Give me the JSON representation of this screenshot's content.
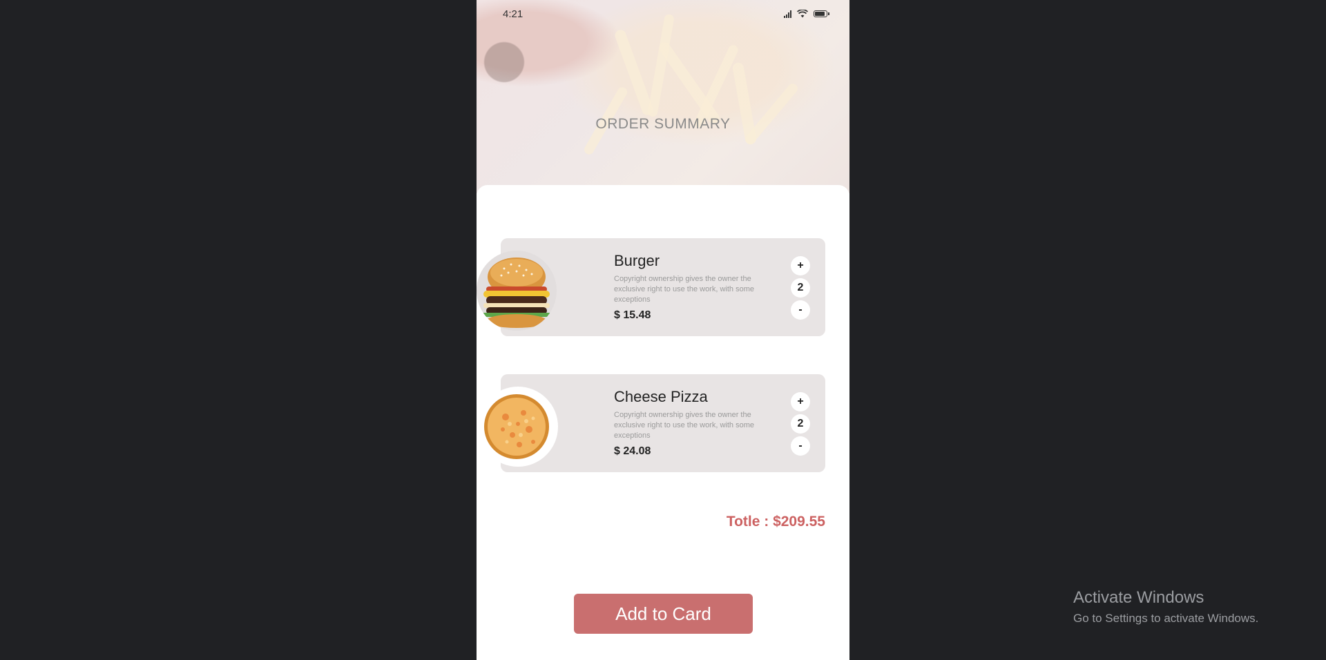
{
  "status_bar": {
    "time": "4:21"
  },
  "header": {
    "title": "ORDER SUMMARY"
  },
  "items": [
    {
      "name": "Burger",
      "description": "Copyright ownership gives the owner the exclusive right to use the work, with some exceptions",
      "price": "$ 15.48",
      "quantity": "2",
      "plus_label": "+",
      "minus_label": "-",
      "image_icon": "burger-image"
    },
    {
      "name": "Cheese Pizza",
      "description": "Copyright ownership gives the owner the exclusive right to use the work, with some exceptions",
      "price": "$ 24.08",
      "quantity": "2",
      "plus_label": "+",
      "minus_label": "-",
      "image_icon": "pizza-image"
    }
  ],
  "total": {
    "label": "Totle : $209.55"
  },
  "cta": {
    "label": "Add to Card"
  },
  "os_watermark": {
    "title": "Activate Windows",
    "subtitle": "Go to Settings to activate Windows."
  },
  "colors": {
    "accent": "#c96f6f",
    "total_text": "#cc6161",
    "card_bg": "#e8e4e4",
    "desktop_bg": "#202124"
  }
}
